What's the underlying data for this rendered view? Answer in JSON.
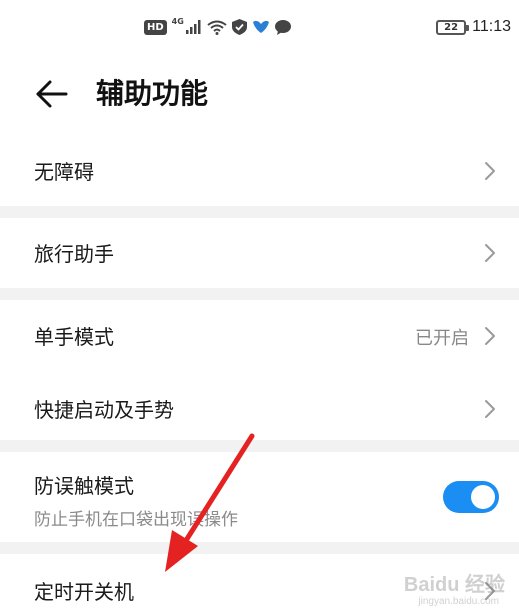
{
  "status_bar": {
    "hd": "HD",
    "network": "4G",
    "battery": "22",
    "time": "11:13",
    "icons": [
      "signal-icon",
      "wifi-icon",
      "shield-icon",
      "bird-icon",
      "chat-icon"
    ]
  },
  "header": {
    "title": "辅助功能",
    "back_icon": "arrow-left-icon"
  },
  "settings": {
    "accessibility": {
      "label": "无障碍"
    },
    "travel_assistant": {
      "label": "旅行助手"
    },
    "one_hand_mode": {
      "label": "单手模式",
      "value": "已开启"
    },
    "quick_start": {
      "label": "快捷启动及手势"
    },
    "pocket_mode": {
      "label": "防误触模式",
      "subtitle": "防止手机在口袋出现误操作",
      "enabled": true
    },
    "scheduled_power": {
      "label": "定时开关机"
    }
  },
  "colors": {
    "accent": "#1a8ef2",
    "annotation": "#e52222",
    "divider": "#f2f2f2"
  },
  "watermark": {
    "brand": "Baidu 经验",
    "url": "jingyan.baidu.com"
  }
}
